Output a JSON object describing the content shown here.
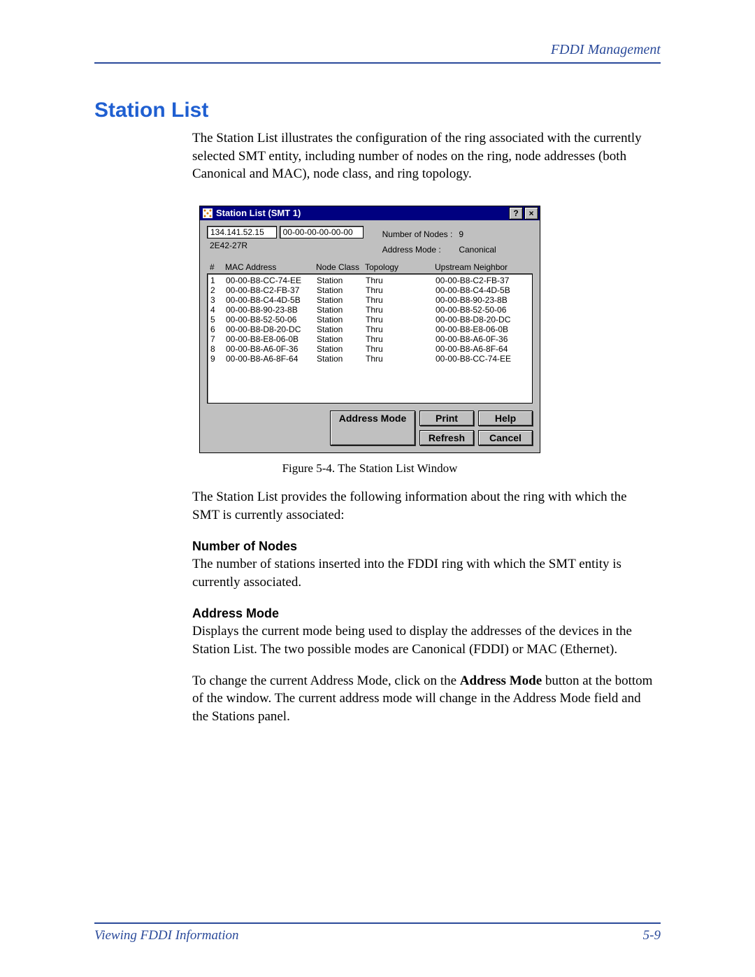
{
  "header": {
    "running_title": "FDDI Management"
  },
  "title": "Station List",
  "intro": "The Station List illustrates the configuration of the ring associated with the currently selected SMT entity, including number of nodes on the ring, node addresses (both Canonical and MAC), node class, and ring topology.",
  "window": {
    "title": "Station List (SMT 1)",
    "help_btn": "?",
    "close_btn": "×",
    "ip": "134.141.52.15",
    "mac": "00-00-00-00-00-00",
    "device": "2E42-27R",
    "nodes_label": "Number of Nodes :",
    "nodes_value": "9",
    "mode_label": "Address Mode :",
    "mode_value": "Canonical",
    "columns": {
      "idx": "#",
      "mac": "MAC Address",
      "class": "Node Class",
      "topo": "Topology",
      "up": "Upstream Neighbor"
    },
    "rows": [
      {
        "idx": "1",
        "mac": "00-00-B8-CC-74-EE",
        "class": "Station",
        "topo": "Thru",
        "up": "00-00-B8-C2-FB-37"
      },
      {
        "idx": "2",
        "mac": "00-00-B8-C2-FB-37",
        "class": "Station",
        "topo": "Thru",
        "up": "00-00-B8-C4-4D-5B"
      },
      {
        "idx": "3",
        "mac": "00-00-B8-C4-4D-5B",
        "class": "Station",
        "topo": "Thru",
        "up": "00-00-B8-90-23-8B"
      },
      {
        "idx": "4",
        "mac": "00-00-B8-90-23-8B",
        "class": "Station",
        "topo": "Thru",
        "up": "00-00-B8-52-50-06"
      },
      {
        "idx": "5",
        "mac": "00-00-B8-52-50-06",
        "class": "Station",
        "topo": "Thru",
        "up": "00-00-B8-D8-20-DC"
      },
      {
        "idx": "6",
        "mac": "00-00-B8-D8-20-DC",
        "class": "Station",
        "topo": "Thru",
        "up": "00-00-B8-E8-06-0B"
      },
      {
        "idx": "7",
        "mac": "00-00-B8-E8-06-0B",
        "class": "Station",
        "topo": "Thru",
        "up": "00-00-B8-A6-0F-36"
      },
      {
        "idx": "8",
        "mac": "00-00-B8-A6-0F-36",
        "class": "Station",
        "topo": "Thru",
        "up": "00-00-B8-A6-8F-64"
      },
      {
        "idx": "9",
        "mac": "00-00-B8-A6-8F-64",
        "class": "Station",
        "topo": "Thru",
        "up": "00-00-B8-CC-74-EE"
      }
    ],
    "buttons": {
      "address_mode": "Address Mode",
      "print": "Print",
      "help": "Help",
      "refresh": "Refresh",
      "cancel": "Cancel"
    }
  },
  "figure_caption": "Figure 5-4. The Station List Window",
  "body2_intro": "The Station List provides the following information about the ring with which the SMT is currently associated:",
  "defs": {
    "nodes_h": "Number of Nodes",
    "nodes_t": "The number of stations inserted into the FDDI ring with which the SMT entity is currently associated.",
    "mode_h": "Address Mode",
    "mode_t": "Displays the current mode being used to display the addresses of the devices in the Station List. The two possible modes are Canonical (FDDI) or MAC (Ethernet).",
    "mode_p2a": "To change the current Address Mode, click on the ",
    "mode_p2b": "Address Mode",
    "mode_p2c": " button at the bottom of the window. The current address mode will change in the Address Mode field and the Stations panel."
  },
  "footer": {
    "left": "Viewing FDDI Information",
    "right": "5-9"
  }
}
